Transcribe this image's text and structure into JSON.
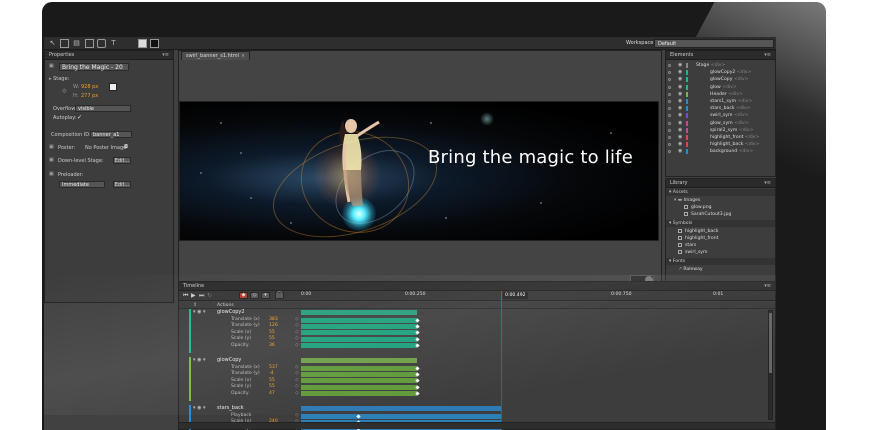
{
  "toolbar": {
    "tools": [
      "select-tool",
      "transform-tool",
      "clipping-tool",
      "rectangle-tool",
      "rounded-rectangle-tool",
      "text-tool"
    ],
    "workspace_label": "Workspace:",
    "workspace_value": "Default"
  },
  "properties": {
    "panel_title": "Properties",
    "element_name": "Bring the Magic - 20",
    "stage_label": "Stage:",
    "w_label": "W:",
    "w_value": "928 px",
    "h_label": "H:",
    "h_value": "277 px",
    "overflow_label": "Overflow:",
    "overflow_value": "visible",
    "autoplay_label": "Autoplay:",
    "autoplay_value": "✓",
    "composition_label": "Composition ID:",
    "composition_value": "banner_a1",
    "poster_label": "Poster:",
    "poster_value": "No Poster Image",
    "downlevel_label": "Down-level Stage:",
    "edit_label": "Edit...",
    "preloader_label": "Preloader:",
    "preloader_value": "Immediate",
    "preloader_edit": "Edit..."
  },
  "stage": {
    "tab": "swirl_banner_s1.html",
    "tab_close": "×",
    "headline": "Bring the magic to life"
  },
  "elements": {
    "panel_title": "Elements",
    "items": [
      {
        "name": "Stage",
        "tag": "<div>",
        "color": "#888888"
      },
      {
        "name": "glowCopy2",
        "tag": "<div>",
        "color": "#1fb88c"
      },
      {
        "name": "glowCopy",
        "tag": "<div>",
        "color": "#1fb88c"
      },
      {
        "name": "glow",
        "tag": "<div>",
        "color": "#1fb88c"
      },
      {
        "name": "Header",
        "tag": "<div>",
        "color": "#7ab648"
      },
      {
        "name": "stars1_sym",
        "tag": "<div>",
        "color": "#2a8ad4"
      },
      {
        "name": "stars_back",
        "tag": "<div>",
        "color": "#2a8ad4"
      },
      {
        "name": "swirl_sym",
        "tag": "<div>",
        "color": "#7a4ad4"
      },
      {
        "name": "glow_sym",
        "tag": "<div>",
        "color": "#c44a9a"
      },
      {
        "name": "spiral2_sym",
        "tag": "<div>",
        "color": "#c44a9a"
      },
      {
        "name": "highlight_front",
        "tag": "<div>",
        "color": "#d44a4a"
      },
      {
        "name": "highlight_back",
        "tag": "<div>",
        "color": "#d44a4a"
      },
      {
        "name": "background",
        "tag": "<div>",
        "color": "#2a8ad4"
      }
    ]
  },
  "library": {
    "panel_title": "Library",
    "assets_label": "Assets",
    "images_label": "Images",
    "images": [
      "glow.png",
      "SarahCutout3.jpg"
    ],
    "symbols_label": "Symbols",
    "symbols": [
      "highlight_back",
      "highlight_front",
      "stars",
      "swirl_sym"
    ],
    "fonts_label": "Fonts",
    "fonts": [
      "Raleway"
    ]
  },
  "timeline": {
    "panel_title": "Timeline",
    "ticks": [
      "0:00",
      "0:00.250",
      "0:00.750",
      "0:01"
    ],
    "playhead": "0:00.492",
    "actions_label": "Actions",
    "elements": [
      {
        "name": "glowCopy2",
        "color": "#1fb88c",
        "track_color": "#1a9f7a",
        "props": [
          {
            "label": "Translate (x)",
            "value": "383"
          },
          {
            "label": "Translate (y)",
            "value": "126"
          },
          {
            "label": "Scale (x)",
            "value": "55"
          },
          {
            "label": "Scale (y)",
            "value": "55"
          },
          {
            "label": "Opacity",
            "value": "36"
          }
        ]
      },
      {
        "name": "glowCopy",
        "color": "#7ab648",
        "track_color": "#5f9a3a",
        "props": [
          {
            "label": "Translate (x)",
            "value": "537"
          },
          {
            "label": "Translate (y)",
            "value": "-4"
          },
          {
            "label": "Scale (x)",
            "value": "55"
          },
          {
            "label": "Scale (y)",
            "value": "55"
          },
          {
            "label": "Opacity",
            "value": "47"
          }
        ]
      },
      {
        "name": "stars_back",
        "color": "#2a8ad4",
        "track_color": "#2d7fb8",
        "props": [
          {
            "label": "Playback",
            "value": ""
          },
          {
            "label": "Scale (x)",
            "value": "240"
          },
          {
            "label": "Scale (y)",
            "value": "240"
          }
        ]
      }
    ]
  }
}
